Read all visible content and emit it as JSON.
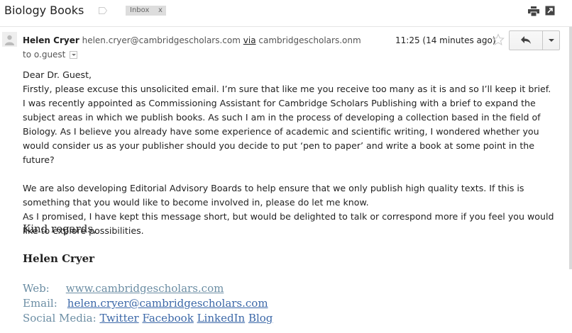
{
  "subject_bar": {
    "subject": "Biology Books",
    "label_chip": "Inbox",
    "label_remove": "x",
    "icons": [
      "label-tag-icon",
      "print-icon",
      "popout-icon"
    ]
  },
  "message_header": {
    "sender_name": "Helen Cryer",
    "sender_email": "helen.cryer@cambridgescholars.com",
    "via_label": "via",
    "via_domain": "cambridgescholars.onmicrosoft.com",
    "recipient_prefix": "to",
    "recipient": "o.guest",
    "timestamp": "11:25 (14 minutes ago)",
    "icons": [
      "avatar-icon",
      "star-icon",
      "reply-icon",
      "chevron-down-icon"
    ]
  },
  "body": {
    "salutation": "Dear Dr. Guest,",
    "paragraphs": [
      "Firstly, please excuse this unsolicited email. I’m sure that like me you receive too many as it is and so I’ll keep it brief.",
      "I was recently appointed as Commissioning Assistant for Cambridge Scholars Publishing with a brief to expand the subject areas in which we publish books. As such I am in the process of developing a collection based in the field of Biology. As I believe you already have some experience of academic and scientific writing, I wondered whether you would consider us as your publisher should you decide to put ‘pen to paper’ and write a book at some point in the future?",
      "We are also developing Editorial Advisory Boards to help ensure that we only publish high quality texts. If this is something that you would like to become involved in, please do let me know.",
      "As I promised, I have kept this message short, but would be delighted to talk or correspond more if you feel you would like to explore possibilities."
    ]
  },
  "signature": {
    "closing": "Kind regards,",
    "name": "Helen Cryer",
    "web_label": "Web:",
    "web_link": "www.cambridgescholars.com",
    "email_label": "Email:",
    "email_link": "helen.cryer@cambridgescholars.com",
    "social_label": "Social Media:",
    "social_links": [
      "Twitter",
      "Facebook",
      "LinkedIn",
      "Blog"
    ]
  },
  "colors": {
    "link": "#3c68a8",
    "signature_label": "#6c8ea4",
    "chip_bg": "#dddddd"
  }
}
